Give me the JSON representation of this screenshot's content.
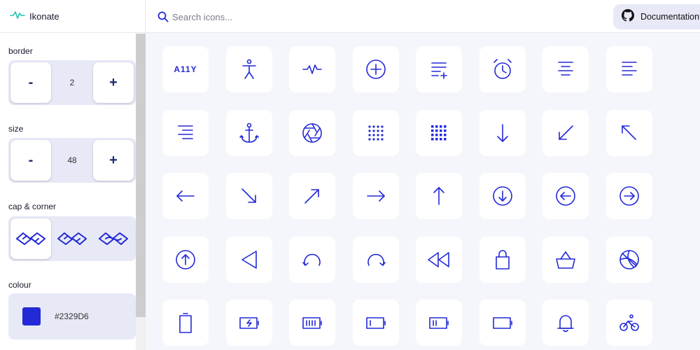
{
  "brand": {
    "name": "Ikonate",
    "logo_icon": "activity-icon"
  },
  "search": {
    "placeholder": "Search icons..."
  },
  "documentation": {
    "label": "Documentation",
    "icon": "github-icon"
  },
  "controls": {
    "border": {
      "label": "border",
      "value": "2",
      "minus": "-",
      "plus": "+"
    },
    "size": {
      "label": "size",
      "value": "48",
      "minus": "-",
      "plus": "+"
    },
    "cap_corner": {
      "label": "cap & corner",
      "options": [
        "square-cap",
        "round-cap",
        "rounded-cap"
      ],
      "selected": 0
    },
    "colour": {
      "label": "colour",
      "value": "#2329D6"
    }
  },
  "accent_color": "#2329D6",
  "icons": [
    {
      "name": "a11y",
      "text": "A11Y"
    },
    {
      "name": "accessibility"
    },
    {
      "name": "activity"
    },
    {
      "name": "add"
    },
    {
      "name": "add-to-list"
    },
    {
      "name": "alarm"
    },
    {
      "name": "align-center"
    },
    {
      "name": "align-left"
    },
    {
      "name": "align-right"
    },
    {
      "name": "anchor"
    },
    {
      "name": "aperture"
    },
    {
      "name": "apps"
    },
    {
      "name": "apps-alt"
    },
    {
      "name": "arrow-down"
    },
    {
      "name": "arrow-down-left"
    },
    {
      "name": "arrow-up-left"
    },
    {
      "name": "arrow-left"
    },
    {
      "name": "arrow-down-right"
    },
    {
      "name": "arrow-up-right"
    },
    {
      "name": "arrow-right"
    },
    {
      "name": "arrow-up"
    },
    {
      "name": "arrow-down-circle"
    },
    {
      "name": "arrow-left-circle"
    },
    {
      "name": "arrow-right-circle"
    },
    {
      "name": "arrow-up-circle"
    },
    {
      "name": "back"
    },
    {
      "name": "back-alt"
    },
    {
      "name": "forward-alt"
    },
    {
      "name": "rewind"
    },
    {
      "name": "bag"
    },
    {
      "name": "basket"
    },
    {
      "name": "basketball"
    },
    {
      "name": "battery-empty"
    },
    {
      "name": "battery-charging"
    },
    {
      "name": "battery-full"
    },
    {
      "name": "battery-low"
    },
    {
      "name": "battery-medium"
    },
    {
      "name": "battery"
    },
    {
      "name": "bell"
    },
    {
      "name": "bike"
    }
  ]
}
